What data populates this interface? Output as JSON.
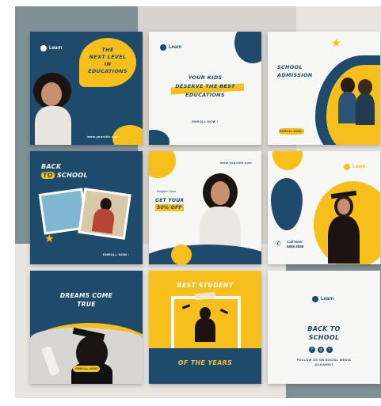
{
  "brand": {
    "logo_text": "Learn",
    "website": "www.yoursite.com"
  },
  "colors": {
    "navy": "#1e4a6b",
    "yellow": "#f6bf1c",
    "white": "#f6f6f4"
  },
  "posts": {
    "p1": {
      "headline_1": "THE",
      "headline_2": "NEXT LEVEL",
      "headline_3": "IN",
      "headline_4": "EDUCATIONS",
      "footer": "www.yoursite.com"
    },
    "p2": {
      "line_1": "YOUR KIDS",
      "line_2": "DESERVE THE BEST",
      "line_3": "EDUCATIONS",
      "cta": "ENROLL NOW  ›"
    },
    "p3": {
      "line_1": "SCHOOL",
      "line_2": "ADMISSION",
      "cta": "ENROLL NOW ›"
    },
    "p4": {
      "line_1": "BACK",
      "line_2": "TO",
      "line_3": "SCHOOL",
      "cta": "ENROLL NOW ›"
    },
    "p5": {
      "website": "www.yoursite.com",
      "small_note": "Register Now",
      "offer_1": "GET YOUR",
      "offer_2": "50% OFF"
    },
    "p6": {
      "call_label": "Call Now",
      "phone": "8888 8888"
    },
    "p7": {
      "line_1": "DREAMS COME",
      "line_2": "TRUE",
      "cta": "ENROLL NOW"
    },
    "p8": {
      "line_1": "BEST STUDENT",
      "line_2": "OF THE YEARS"
    },
    "p9": {
      "line_1": "BACK TO",
      "line_2": "SCHOOL",
      "social": "FOLLOW US ON SOCIAL MEDIA",
      "handle": "@LEARNIT"
    }
  }
}
